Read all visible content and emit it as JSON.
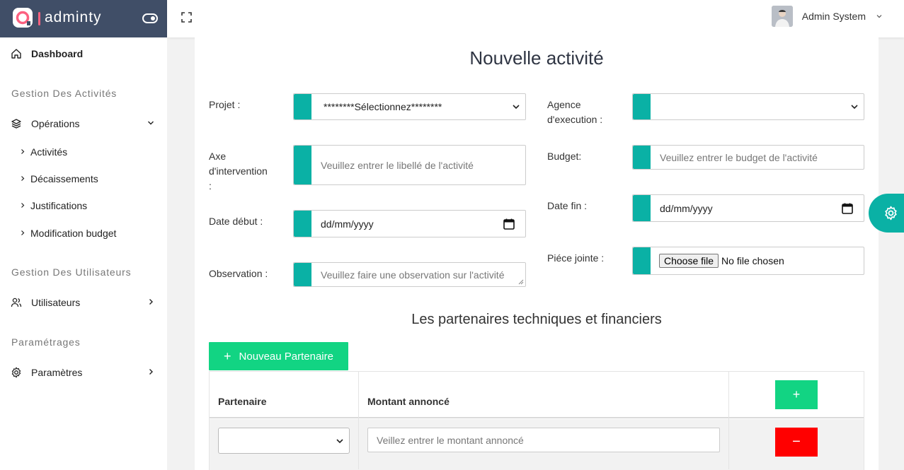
{
  "brand": {
    "name": "adminty"
  },
  "user": {
    "name": "Admin System"
  },
  "sidebar": {
    "dashboard": "Dashboard",
    "section_activities": "Gestion Des Activités",
    "operations": "Opérations",
    "sub_items": [
      "Activités",
      "Décaissements",
      "Justifications",
      "Modification budget"
    ],
    "section_users": "Gestion Des Utilisateurs",
    "users": "Utilisateurs",
    "section_settings": "Paramétrages",
    "settings": "Paramètres"
  },
  "form": {
    "title": "Nouvelle activité",
    "projet_label": "Projet :",
    "projet_value": "********Sélectionnez********",
    "agence_label_1": "Agence",
    "agence_label_2": "d'execution :",
    "agence_value": "",
    "axe_label_1": "Axe",
    "axe_label_2": "d'intervention",
    "axe_label_3": ":",
    "axe_placeholder": "Veuillez entrer le libellé de l'activité",
    "budget_label": "Budget:",
    "budget_placeholder": "Veuillez entrer le budget de l'activité",
    "date_debut_label": "Date début :",
    "date_debut_value": "dd/mm/yyyy",
    "date_fin_label": "Date fin :",
    "date_fin_value": "dd/mm/yyyy",
    "observation_label": "Observation :",
    "observation_placeholder": "Veuillez faire une observation sur l'activité",
    "piece_label": "Piéce jointe :",
    "file_button": "Choose file",
    "file_status": "No file chosen"
  },
  "partners": {
    "title": "Les partenaires techniques et financiers",
    "new_button": "Nouveau Partenaire",
    "col_partner": "Partenaire",
    "col_amount": "Montant annoncé",
    "add_symbol": "+",
    "remove_symbol": "−",
    "row_partner_value": "",
    "amount_placeholder": "Veillez entrer le montant annoncé"
  },
  "colors": {
    "accent": "#0ab1a5",
    "success": "#12d483",
    "danger": "#ff0000",
    "header": "#404e67"
  }
}
